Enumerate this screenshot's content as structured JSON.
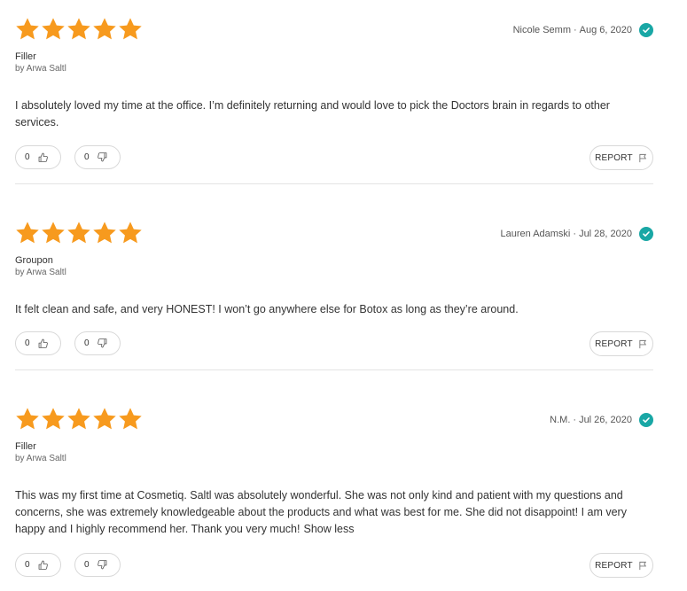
{
  "colors": {
    "star": "#f79a1e",
    "verified": "#19a7a5",
    "border": "#d8d8d8"
  },
  "reviews": [
    {
      "rating": 5,
      "author": "Nicole Semm",
      "date": "Aug 6, 2020",
      "service": "Filler",
      "byline": "by Arwa Saltl",
      "text": "I absolutely loved my time at the office. I’m definitely returning and would love to pick the Doctors brain in regards to other services.",
      "helpful": "0",
      "unhelpful": "0",
      "report_label": "REPORT"
    },
    {
      "rating": 5,
      "author": "Lauren Adamski",
      "date": "Jul 28, 2020",
      "service": "Groupon",
      "byline": "by Arwa Saltl",
      "text": "It felt clean and safe, and very HONEST! I won’t go anywhere else for Botox as long as they’re around.",
      "helpful": "0",
      "unhelpful": "0",
      "report_label": "REPORT"
    },
    {
      "rating": 5,
      "author": "N.M.",
      "date": "Jul 26, 2020",
      "service": "Filler",
      "byline": "by Arwa Saltl",
      "text": "This was my first time at Cosmetiq. Saltl was absolutely wonderful. She was not only kind and patient with my questions and concerns, she was extremely knowledgeable about the products and what was best for me. She did not disappoint! I am very happy and I highly recommend her. Thank you very much!",
      "show_less_label": "Show less",
      "helpful": "0",
      "unhelpful": "0",
      "report_label": "REPORT"
    }
  ],
  "separator": "·"
}
